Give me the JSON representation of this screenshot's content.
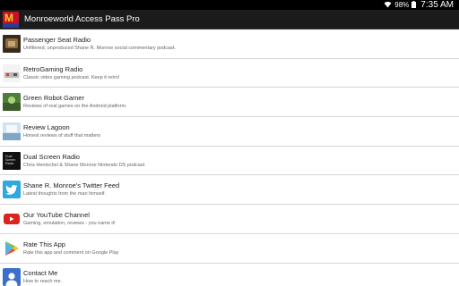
{
  "status_bar": {
    "battery_percent": "98%",
    "time": "7:35 AM",
    "icons": [
      "wifi-icon",
      "battery-icon"
    ]
  },
  "action_bar": {
    "title": "Monroeworld Access Pass Pro",
    "logo_colors": [
      "#c8102e",
      "#f6d31d",
      "#2a3d96"
    ]
  },
  "items": [
    {
      "title": "Passenger Seat Radio",
      "desc": "Unfiltered, unproduced Shane R. Monroe social commentary podcast."
    },
    {
      "title": "RetroGaming Radio",
      "desc": "Classic video gaming podcast.  Keep it retro!"
    },
    {
      "title": "Green Robot Gamer",
      "desc": "Reviews of real games on the Android platform."
    },
    {
      "title": "Review Lagoon",
      "desc": "Honest reviews of stuff that matters"
    },
    {
      "title": "Dual Screen Radio",
      "desc": "Chris Hentschel & Shane Monroe Nintendo DS podcast",
      "thumb_text": [
        "Dual",
        "Screen",
        "Radio"
      ]
    },
    {
      "title": "Shane R. Monroe's Twitter Feed",
      "desc": "Latest thoughts from the man himself."
    },
    {
      "title": "Our YouTube Channel",
      "desc": "Gaming, emulation, reviews - you name it!"
    },
    {
      "title": "Rate This App",
      "desc": "Rate this app and comment on Google Play"
    },
    {
      "title": "Contact Me",
      "desc": "How to reach me."
    }
  ]
}
